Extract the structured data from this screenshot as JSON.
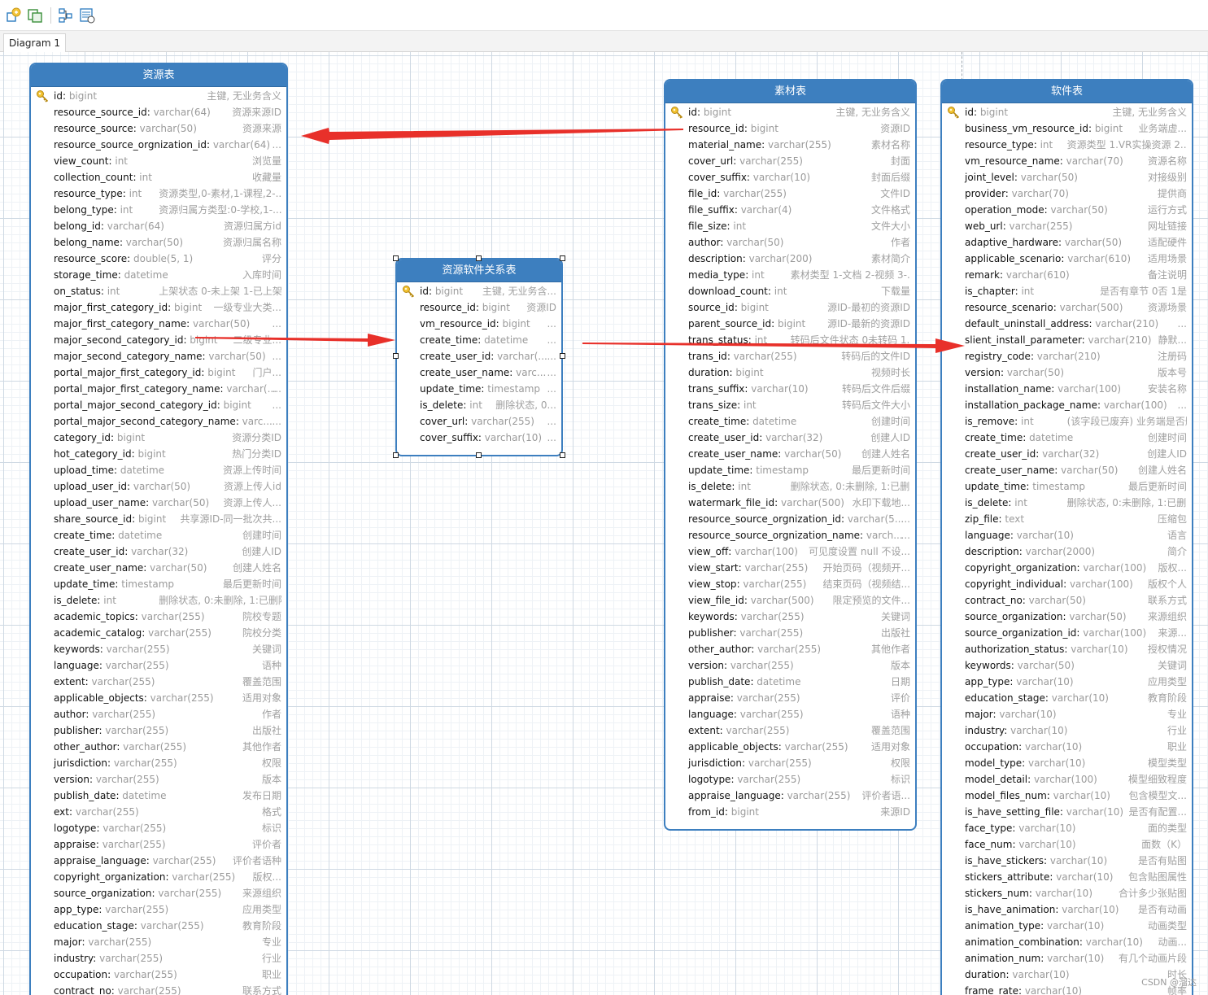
{
  "tab": {
    "label": "Diagram 1"
  },
  "toolbar": {
    "icons": [
      "entity-add-icon",
      "entity-copy-icon",
      "layout-icon",
      "relation-icon"
    ]
  },
  "watermark": "CSDN @溜达",
  "arrow_color": "#e8302a",
  "header_color": "#3d7fbf",
  "tables": {
    "resource": {
      "title": "资源表",
      "fields": [
        {
          "name": "id",
          "type": "bigint",
          "comment": "主键, 无业务含义",
          "pk": true
        },
        {
          "name": "resource_source_id",
          "type": "varchar(64)",
          "comment": "资源来源ID"
        },
        {
          "name": "resource_source",
          "type": "varchar(50)",
          "comment": "资源来源"
        },
        {
          "name": "resource_source_orgnization_id",
          "type": "varchar(64)",
          "comment": "..."
        },
        {
          "name": "view_count",
          "type": "int",
          "comment": "浏览量"
        },
        {
          "name": "collection_count",
          "type": "int",
          "comment": "收藏量"
        },
        {
          "name": "resource_type",
          "type": "int",
          "comment": "资源类型,0-素材,1-课程,2-..."
        },
        {
          "name": "belong_type",
          "type": "int",
          "comment": "资源归属方类型:0-学校,1-..."
        },
        {
          "name": "belong_id",
          "type": "varchar(64)",
          "comment": "资源归属方id"
        },
        {
          "name": "belong_name",
          "type": "varchar(50)",
          "comment": "资源归属名称"
        },
        {
          "name": "resource_score",
          "type": "double(5, 1)",
          "comment": "评分"
        },
        {
          "name": "storage_time",
          "type": "datetime",
          "comment": "入库时间"
        },
        {
          "name": "on_status",
          "type": "int",
          "comment": "上架状态 0-未上架 1-已上架 2-..."
        },
        {
          "name": "major_first_category_id",
          "type": "bigint",
          "comment": "一级专业大类..."
        },
        {
          "name": "major_first_category_name",
          "type": "varchar(50)",
          "comment": "..."
        },
        {
          "name": "major_second_category_id",
          "type": "bigint",
          "comment": "二级专业..."
        },
        {
          "name": "major_second_category_name",
          "type": "varchar(50)",
          "comment": "..."
        },
        {
          "name": "portal_major_first_category_id",
          "type": "bigint",
          "comment": "门户..."
        },
        {
          "name": "portal_major_first_category_name",
          "type": "varchar(...",
          "comment": "..."
        },
        {
          "name": "portal_major_second_category_id",
          "type": "bigint",
          "comment": "..."
        },
        {
          "name": "portal_major_second_category_name",
          "type": "varc...",
          "comment": "..."
        },
        {
          "name": "category_id",
          "type": "bigint",
          "comment": "资源分类ID"
        },
        {
          "name": "hot_category_id",
          "type": "bigint",
          "comment": "热门分类ID"
        },
        {
          "name": "upload_time",
          "type": "datetime",
          "comment": "资源上传时间"
        },
        {
          "name": "upload_user_id",
          "type": "varchar(50)",
          "comment": "资源上传人id"
        },
        {
          "name": "upload_user_name",
          "type": "varchar(50)",
          "comment": "资源上传人..."
        },
        {
          "name": "share_source_id",
          "type": "bigint",
          "comment": "共享源ID-同一批次共..."
        },
        {
          "name": "create_time",
          "type": "datetime",
          "comment": "创建时间"
        },
        {
          "name": "create_user_id",
          "type": "varchar(32)",
          "comment": "创建人ID"
        },
        {
          "name": "create_user_name",
          "type": "varchar(50)",
          "comment": "创建人姓名"
        },
        {
          "name": "update_time",
          "type": "timestamp",
          "comment": "最后更新时间"
        },
        {
          "name": "is_delete",
          "type": "int",
          "comment": "删除状态, 0:未删除, 1:已删除"
        },
        {
          "name": "academic_topics",
          "type": "varchar(255)",
          "comment": "院校专题"
        },
        {
          "name": "academic_catalog",
          "type": "varchar(255)",
          "comment": "院校分类"
        },
        {
          "name": "keywords",
          "type": "varchar(255)",
          "comment": "关键词"
        },
        {
          "name": "language",
          "type": "varchar(255)",
          "comment": "语种"
        },
        {
          "name": "extent",
          "type": "varchar(255)",
          "comment": "覆盖范围"
        },
        {
          "name": "applicable_objects",
          "type": "varchar(255)",
          "comment": "适用对象"
        },
        {
          "name": "author",
          "type": "varchar(255)",
          "comment": "作者"
        },
        {
          "name": "publisher",
          "type": "varchar(255)",
          "comment": "出版社"
        },
        {
          "name": "other_author",
          "type": "varchar(255)",
          "comment": "其他作者"
        },
        {
          "name": "jurisdiction",
          "type": "varchar(255)",
          "comment": "权限"
        },
        {
          "name": "version",
          "type": "varchar(255)",
          "comment": "版本"
        },
        {
          "name": "publish_date",
          "type": "datetime",
          "comment": "发布日期"
        },
        {
          "name": "ext",
          "type": "varchar(255)",
          "comment": "格式"
        },
        {
          "name": "logotype",
          "type": "varchar(255)",
          "comment": "标识"
        },
        {
          "name": "appraise",
          "type": "varchar(255)",
          "comment": "评价者"
        },
        {
          "name": "appraise_language",
          "type": "varchar(255)",
          "comment": "评价者语种"
        },
        {
          "name": "copyright_organization",
          "type": "varchar(255)",
          "comment": "版权..."
        },
        {
          "name": "source_organization",
          "type": "varchar(255)",
          "comment": "来源组织"
        },
        {
          "name": "app_type",
          "type": "varchar(255)",
          "comment": "应用类型"
        },
        {
          "name": "education_stage",
          "type": "varchar(255)",
          "comment": "教育阶段"
        },
        {
          "name": "major",
          "type": "varchar(255)",
          "comment": "专业"
        },
        {
          "name": "industry",
          "type": "varchar(255)",
          "comment": "行业"
        },
        {
          "name": "occupation",
          "type": "varchar(255)",
          "comment": "职业"
        },
        {
          "name": "contract_no",
          "type": "varchar(255)",
          "comment": "联系方式"
        }
      ]
    },
    "relation": {
      "title": "资源软件关系表",
      "fields": [
        {
          "name": "id",
          "type": "bigint",
          "comment": "主键, 无业务含...",
          "pk": true
        },
        {
          "name": "resource_id",
          "type": "bigint",
          "comment": "资源ID"
        },
        {
          "name": "vm_resource_id",
          "type": "bigint",
          "comment": "..."
        },
        {
          "name": "create_time",
          "type": "datetime",
          "comment": "..."
        },
        {
          "name": "create_user_id",
          "type": "varchar(...",
          "comment": "..."
        },
        {
          "name": "create_user_name",
          "type": "varc...",
          "comment": "..."
        },
        {
          "name": "update_time",
          "type": "timestamp",
          "comment": "..."
        },
        {
          "name": "is_delete",
          "type": "int",
          "comment": "删除状态, 0..."
        },
        {
          "name": "cover_url",
          "type": "varchar(255)",
          "comment": "..."
        },
        {
          "name": "cover_suffix",
          "type": "varchar(10)",
          "comment": "..."
        }
      ]
    },
    "material": {
      "title": "素材表",
      "fields": [
        {
          "name": "id",
          "type": "bigint",
          "comment": "主键, 无业务含义",
          "pk": true
        },
        {
          "name": "resource_id",
          "type": "bigint",
          "comment": "资源ID"
        },
        {
          "name": "material_name",
          "type": "varchar(255)",
          "comment": "素材名称"
        },
        {
          "name": "cover_url",
          "type": "varchar(255)",
          "comment": "封面"
        },
        {
          "name": "cover_suffix",
          "type": "varchar(10)",
          "comment": "封面后缀"
        },
        {
          "name": "file_id",
          "type": "varchar(255)",
          "comment": "文件ID"
        },
        {
          "name": "file_suffix",
          "type": "varchar(4)",
          "comment": "文件格式"
        },
        {
          "name": "file_size",
          "type": "int",
          "comment": "文件大小"
        },
        {
          "name": "author",
          "type": "varchar(50)",
          "comment": "作者"
        },
        {
          "name": "description",
          "type": "varchar(200)",
          "comment": "素材简介"
        },
        {
          "name": "media_type",
          "type": "int",
          "comment": "素材类型 1-文档 2-视频 3-..."
        },
        {
          "name": "download_count",
          "type": "int",
          "comment": "下载量"
        },
        {
          "name": "source_id",
          "type": "bigint",
          "comment": "源ID-最初的资源ID"
        },
        {
          "name": "parent_source_id",
          "type": "bigint",
          "comment": "源ID-最新的资源ID"
        },
        {
          "name": "trans_status",
          "type": "int",
          "comment": "转码后文件状态 0未转码 1..."
        },
        {
          "name": "trans_id",
          "type": "varchar(255)",
          "comment": "转码后的文件ID"
        },
        {
          "name": "duration",
          "type": "bigint",
          "comment": "视频时长"
        },
        {
          "name": "trans_suffix",
          "type": "varchar(10)",
          "comment": "转码后文件后缀"
        },
        {
          "name": "trans_size",
          "type": "int",
          "comment": "转码后文件大小"
        },
        {
          "name": "create_time",
          "type": "datetime",
          "comment": "创建时间"
        },
        {
          "name": "create_user_id",
          "type": "varchar(32)",
          "comment": "创建人ID"
        },
        {
          "name": "create_user_name",
          "type": "varchar(50)",
          "comment": "创建人姓名"
        },
        {
          "name": "update_time",
          "type": "timestamp",
          "comment": "最后更新时间"
        },
        {
          "name": "is_delete",
          "type": "int",
          "comment": "删除状态, 0:未删除, 1:已删除"
        },
        {
          "name": "watermark_file_id",
          "type": "varchar(500)",
          "comment": "水印下载地..."
        },
        {
          "name": "resource_source_orgnization_id",
          "type": "varchar(5...",
          "comment": "..."
        },
        {
          "name": "resource_source_orgnization_name",
          "type": "varch...",
          "comment": "..."
        },
        {
          "name": "view_off",
          "type": "varchar(100)",
          "comment": "可见度设置 null 不设..."
        },
        {
          "name": "view_start",
          "type": "varchar(255)",
          "comment": "开始页码（视频开..."
        },
        {
          "name": "view_stop",
          "type": "varchar(255)",
          "comment": "结束页码（视频结..."
        },
        {
          "name": "view_file_id",
          "type": "varchar(500)",
          "comment": "限定预览的文件..."
        },
        {
          "name": "keywords",
          "type": "varchar(255)",
          "comment": "关键词"
        },
        {
          "name": "publisher",
          "type": "varchar(255)",
          "comment": "出版社"
        },
        {
          "name": "other_author",
          "type": "varchar(255)",
          "comment": "其他作者"
        },
        {
          "name": "version",
          "type": "varchar(255)",
          "comment": "版本"
        },
        {
          "name": "publish_date",
          "type": "datetime",
          "comment": "日期"
        },
        {
          "name": "appraise",
          "type": "varchar(255)",
          "comment": "评价"
        },
        {
          "name": "language",
          "type": "varchar(255)",
          "comment": "语种"
        },
        {
          "name": "extent",
          "type": "varchar(255)",
          "comment": "覆盖范围"
        },
        {
          "name": "applicable_objects",
          "type": "varchar(255)",
          "comment": "适用对象"
        },
        {
          "name": "jurisdiction",
          "type": "varchar(255)",
          "comment": "权限"
        },
        {
          "name": "logotype",
          "type": "varchar(255)",
          "comment": "标识"
        },
        {
          "name": "appraise_language",
          "type": "varchar(255)",
          "comment": "评价者语..."
        },
        {
          "name": "from_id",
          "type": "bigint",
          "comment": "来源ID"
        }
      ]
    },
    "software": {
      "title": "软件表",
      "fields": [
        {
          "name": "id",
          "type": "bigint",
          "comment": "主键, 无业务含义",
          "pk": true
        },
        {
          "name": "business_vm_resource_id",
          "type": "bigint",
          "comment": "业务端虚..."
        },
        {
          "name": "resource_type",
          "type": "int",
          "comment": "资源类型 1.VR实操资源 2..."
        },
        {
          "name": "vm_resource_name",
          "type": "varchar(70)",
          "comment": "资源名称"
        },
        {
          "name": "joint_level",
          "type": "varchar(50)",
          "comment": "对接级别"
        },
        {
          "name": "provider",
          "type": "varchar(70)",
          "comment": "提供商"
        },
        {
          "name": "operation_mode",
          "type": "varchar(50)",
          "comment": "运行方式"
        },
        {
          "name": "web_url",
          "type": "varchar(255)",
          "comment": "网址链接"
        },
        {
          "name": "adaptive_hardware",
          "type": "varchar(50)",
          "comment": "适配硬件"
        },
        {
          "name": "applicable_scenario",
          "type": "varchar(610)",
          "comment": "适用场景"
        },
        {
          "name": "remark",
          "type": "varchar(610)",
          "comment": "备注说明"
        },
        {
          "name": "is_chapter",
          "type": "int",
          "comment": "是否有章节 0否 1是"
        },
        {
          "name": "resource_scenario",
          "type": "varchar(500)",
          "comment": "资源场景"
        },
        {
          "name": "default_uninstall_address",
          "type": "varchar(210)",
          "comment": "..."
        },
        {
          "name": "slient_install_parameter",
          "type": "varchar(210)",
          "comment": "静默..."
        },
        {
          "name": "registry_code",
          "type": "varchar(210)",
          "comment": "注册码"
        },
        {
          "name": "version",
          "type": "varchar(50)",
          "comment": "版本号"
        },
        {
          "name": "installation_name",
          "type": "varchar(100)",
          "comment": "安装名称"
        },
        {
          "name": "installation_package_name",
          "type": "varchar(100)",
          "comment": "..."
        },
        {
          "name": "is_remove",
          "type": "int",
          "comment": "(该字段已废弃) 业务端是否删..."
        },
        {
          "name": "create_time",
          "type": "datetime",
          "comment": "创建时间"
        },
        {
          "name": "create_user_id",
          "type": "varchar(32)",
          "comment": "创建人ID"
        },
        {
          "name": "create_user_name",
          "type": "varchar(50)",
          "comment": "创建人姓名"
        },
        {
          "name": "update_time",
          "type": "timestamp",
          "comment": "最后更新时间"
        },
        {
          "name": "is_delete",
          "type": "int",
          "comment": "删除状态, 0:未删除, 1:已删除"
        },
        {
          "name": "zip_file",
          "type": "text",
          "comment": "压缩包"
        },
        {
          "name": "language",
          "type": "varchar(10)",
          "comment": "语言"
        },
        {
          "name": "description",
          "type": "varchar(2000)",
          "comment": "简介"
        },
        {
          "name": "copyright_organization",
          "type": "varchar(100)",
          "comment": "版权..."
        },
        {
          "name": "copyright_individual",
          "type": "varchar(100)",
          "comment": "版权个人"
        },
        {
          "name": "contract_no",
          "type": "varchar(50)",
          "comment": "联系方式"
        },
        {
          "name": "source_organization",
          "type": "varchar(50)",
          "comment": "来源组织"
        },
        {
          "name": "source_organization_id",
          "type": "varchar(100)",
          "comment": "来源..."
        },
        {
          "name": "authorization_status",
          "type": "varchar(10)",
          "comment": "授权情况"
        },
        {
          "name": "keywords",
          "type": "varchar(50)",
          "comment": "关键词"
        },
        {
          "name": "app_type",
          "type": "varchar(10)",
          "comment": "应用类型"
        },
        {
          "name": "education_stage",
          "type": "varchar(10)",
          "comment": "教育阶段"
        },
        {
          "name": "major",
          "type": "varchar(10)",
          "comment": "专业"
        },
        {
          "name": "industry",
          "type": "varchar(10)",
          "comment": "行业"
        },
        {
          "name": "occupation",
          "type": "varchar(10)",
          "comment": "职业"
        },
        {
          "name": "model_type",
          "type": "varchar(10)",
          "comment": "模型类型"
        },
        {
          "name": "model_detail",
          "type": "varchar(100)",
          "comment": "模型细致程度"
        },
        {
          "name": "model_files_num",
          "type": "varchar(10)",
          "comment": "包含模型文..."
        },
        {
          "name": "is_have_setting_file",
          "type": "varchar(10)",
          "comment": "是否有配置..."
        },
        {
          "name": "face_type",
          "type": "varchar(10)",
          "comment": "面的类型"
        },
        {
          "name": "face_num",
          "type": "varchar(10)",
          "comment": "面数（K）"
        },
        {
          "name": "is_have_stickers",
          "type": "varchar(10)",
          "comment": "是否有贴图"
        },
        {
          "name": "stickers_attribute",
          "type": "varchar(10)",
          "comment": "包含贴图属性"
        },
        {
          "name": "stickers_num",
          "type": "varchar(10)",
          "comment": "合计多少张贴图"
        },
        {
          "name": "is_have_animation",
          "type": "varchar(10)",
          "comment": "是否有动画"
        },
        {
          "name": "animation_type",
          "type": "varchar(10)",
          "comment": "动画类型"
        },
        {
          "name": "animation_combination",
          "type": "varchar(10)",
          "comment": "动画..."
        },
        {
          "name": "animation_num",
          "type": "varchar(10)",
          "comment": "有几个动画片段"
        },
        {
          "name": "duration",
          "type": "varchar(10)",
          "comment": "时长"
        },
        {
          "name": "frame_rate",
          "type": "varchar(10)",
          "comment": "帧率"
        }
      ]
    }
  }
}
